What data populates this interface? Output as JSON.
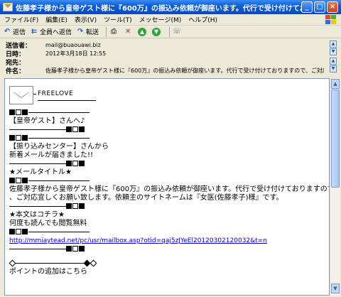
{
  "window": {
    "title": "佐藤孝子様から皇帝ゲスト様に『600万』の振込み依頼が御座います。代行で受け付けておりますので、ご…",
    "min": "_",
    "max": "□",
    "close": "×"
  },
  "menu": [
    "ファイル(F)",
    "編集(E)",
    "表示(V)",
    "ツール(T)",
    "メッセージ(M)",
    "ヘルプ(H)"
  ],
  "toolbar": {
    "reply": "返信",
    "reply_all": "全員へ返信",
    "forward": "転送"
  },
  "header": {
    "from_label": "送信者：",
    "from_value": "mail@buaouawi.biz",
    "date_label": "日時：",
    "date_value": "2012年3月18日 12:55",
    "to_label": "宛先：",
    "to_value": "",
    "subject_label": "件名：",
    "subject_value": "佐藤孝子様から皇帝ゲスト様に『600万』の振込み依頼が御座います。代行で受け付けておりますので、ご対応宜しくお願い致しま"
  },
  "body": {
    "logo_text": "FREELOVE",
    "greeting": "【皇帝ゲスト】さんへ♪",
    "center_line1": "【振り込みセンター】さんから",
    "center_line2": "新着メールが届きました!!",
    "title_heading": "★メールタイトル★",
    "msg_line1": "佐藤孝子様から皇帝ゲスト様に『600万』の振込み依頼が御座います。代行で受け付けておりますので",
    "msg_line2": "、ご対応宜しくお願い致します。依頼主のサイトネームは『女医(佐藤孝子)様』です。",
    "read_heading": "★本文はコチラ★",
    "read_note": "何度も読んでも閲覧無料",
    "link": "http://mmiaytead.net/pc/usr/mailbox.asp?otid=qaj5zJYeEl20120302120032&t=n",
    "points": "ポイントの追加はこちら"
  },
  "colors": {
    "title_bar": "#0a5fd8",
    "link": "#0000cc"
  }
}
